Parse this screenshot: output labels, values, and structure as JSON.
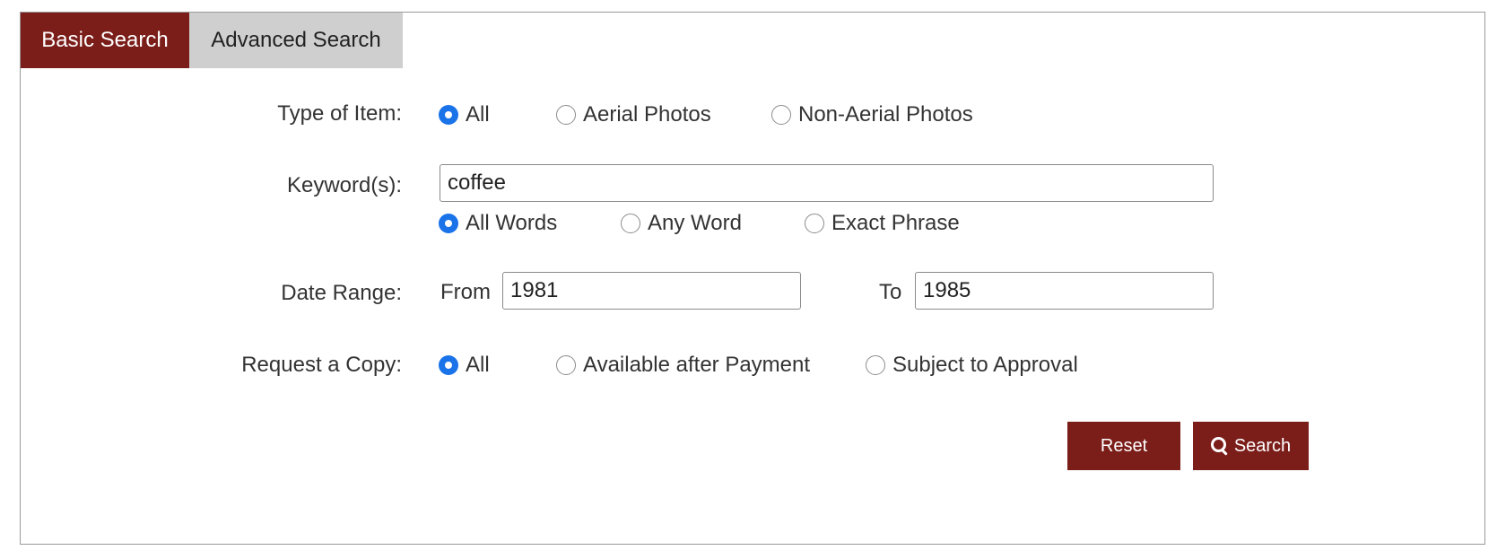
{
  "tabs": [
    {
      "label": "Basic Search",
      "active": true
    },
    {
      "label": "Advanced Search",
      "active": false
    }
  ],
  "type_of_item": {
    "label": "Type of Item:",
    "options": [
      "All",
      "Aerial Photos",
      "Non-Aerial Photos"
    ],
    "selected": "All"
  },
  "keywords": {
    "label": "Keyword(s):",
    "value": "coffee",
    "match_options": [
      "All Words",
      "Any Word",
      "Exact Phrase"
    ],
    "selected": "All Words"
  },
  "date_range": {
    "label": "Date Range:",
    "from_label": "From",
    "from_value": "1981",
    "to_label": "To",
    "to_value": "1985"
  },
  "request_copy": {
    "label": "Request a Copy:",
    "options": [
      "All",
      "Available after Payment",
      "Subject to Approval"
    ],
    "selected": "All"
  },
  "buttons": {
    "reset": "Reset",
    "search": "Search"
  },
  "colors": {
    "accent": "#7b1e1a",
    "tab_inactive": "#cfcfcf",
    "radio_checked": "#1a73e8"
  }
}
